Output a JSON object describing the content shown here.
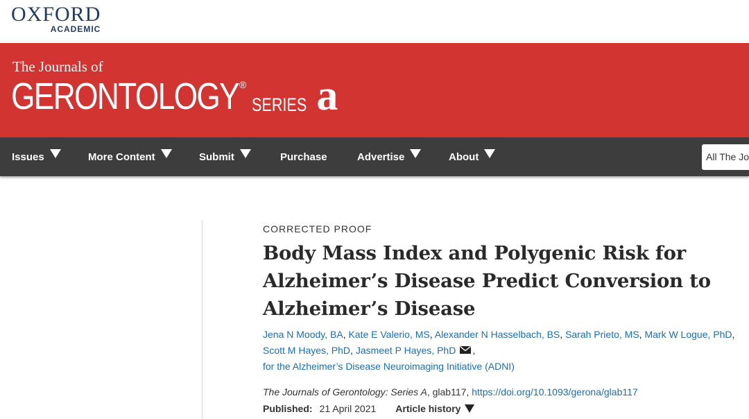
{
  "publisher": {
    "name": "OXFORD",
    "sub": "ACADEMIC"
  },
  "journal": {
    "prefix": "The Journals of",
    "title": "GERONTOLOGY",
    "reg": "®",
    "series": "SERIES",
    "letter": "a"
  },
  "nav": {
    "items": [
      {
        "label": "Issues",
        "dropdown": true
      },
      {
        "label": "More Content",
        "dropdown": true
      },
      {
        "label": "Submit",
        "dropdown": true
      },
      {
        "label": "Purchase",
        "dropdown": false
      },
      {
        "label": "Advertise",
        "dropdown": true
      },
      {
        "label": "About",
        "dropdown": true
      }
    ],
    "search_value": "All The Jou"
  },
  "article": {
    "kicker": "CORRECTED PROOF",
    "title": "Body Mass Index and Polygenic Risk for Alzheimer’s Disease Predict Conversion to Alzheimer’s Disease",
    "authors": [
      "Jena N Moody, BA",
      "Kate E Valerio, MS",
      "Alexander N Hasselbach, BS",
      "Sarah Prieto, MS",
      "Mark W Logue, PhD",
      "Scott M Hayes, PhD",
      "Jasmeet P Hayes, PhD"
    ],
    "group": "for the Alzheimer’s Disease Neuroimaging Initiative (ADNI)",
    "citation_journal": "The Journals of Gerontology: Series A",
    "citation_id": ", glab117,",
    "doi": "https://doi.org/10.1093/gerona/glab117",
    "published_label": "Published:",
    "published_date": "21 April 2021",
    "history_label": "Article history"
  },
  "colors": {
    "banner": "#d23431",
    "nav": "#3d3d3d",
    "link": "#1a6fb3",
    "brand": "#1f3c66"
  }
}
